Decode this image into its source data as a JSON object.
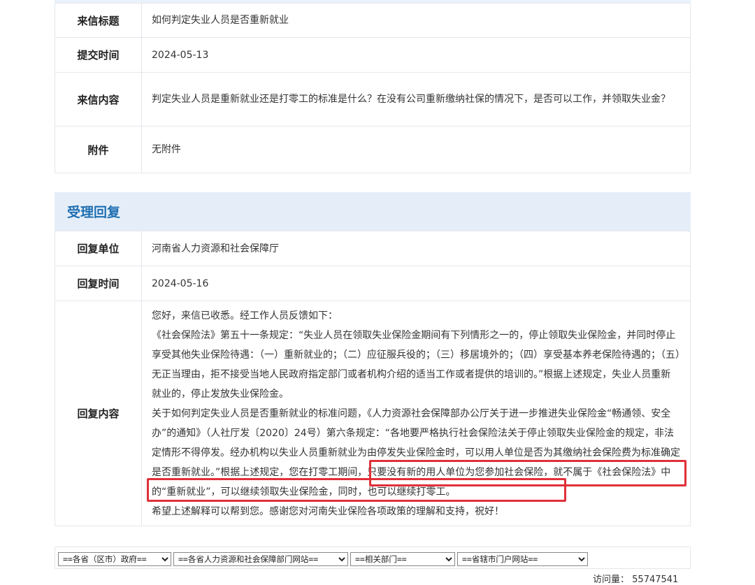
{
  "letter": {
    "title_label": "来信标题",
    "title_value": "如何判定失业人员是否重新就业",
    "submit_time_label": "提交时间",
    "submit_time_value": "2024-05-13",
    "content_label": "来信内容",
    "content_value": "判定失业人员是重新就业还是打零工的标准是什么？在没有公司重新缴纳社保的情况下，是否可以工作，并领取失业金？",
    "attachment_label": "附件",
    "attachment_value": "无附件"
  },
  "reply": {
    "section_title": "受理回复",
    "unit_label": "回复单位",
    "unit_value": "河南省人力资源和社会保障厅",
    "time_label": "回复时间",
    "time_value": "2024-05-16",
    "content_label": "回复内容",
    "paragraphs": [
      "您好，来信已收悉。经工作人员反馈如下：",
      "《社会保险法》第五十一条规定：“失业人员在领取失业保险金期间有下列情形之一的，停止领取失业保险金，并同时停止享受其他失业保险待遇：（一）重新就业的；（二）应征服兵役的；（三）移居境外的；（四）享受基本养老保险待遇的；（五）无正当理由，拒不接受当地人民政府指定部门或者机构介绍的适当工作或者提供的培训的。”根据上述规定，失业人员重新就业的，停止发放失业保险金。",
      "关于如何判定失业人员是否重新就业的标准问题，《人力资源社会保障部办公厅关于进一步推进失业保险金“畅通领、安全办”的通知》（人社厅发〔2020〕24号）第六条规定：“各地要严格执行社会保险法关于停止领取失业保险金的规定，非法定情形不得停发。经办机构以失业人员重新就业为由停发失业保险金时，可以用人单位是否为其缴纳社会保险费为标准确定是否重新就业。”根据上述规定，您在打零工期间，只要没有新的用人单位为您参加社会保险，就不属于《社会保险法》中的“重新就业”，可以继续领取失业保险金，同时，也可以继续打零工。",
      "希望上述解释可以帮到您。感谢您对河南失业保险各项政策的理解和支持，祝好！"
    ]
  },
  "footer": {
    "select_1": "==各省（区市）政府==",
    "select_2": "==各省人力资源和社会保障部门网站==",
    "select_3": "==相关部门==",
    "select_4": "==省辖市门户网站==",
    "visits_label": "访问量：",
    "visits_value": "55747541"
  },
  "colors": {
    "section_header_bg": "#e5eef8",
    "section_title": "#1f6fb2",
    "highlight_box": "#e0303a"
  }
}
